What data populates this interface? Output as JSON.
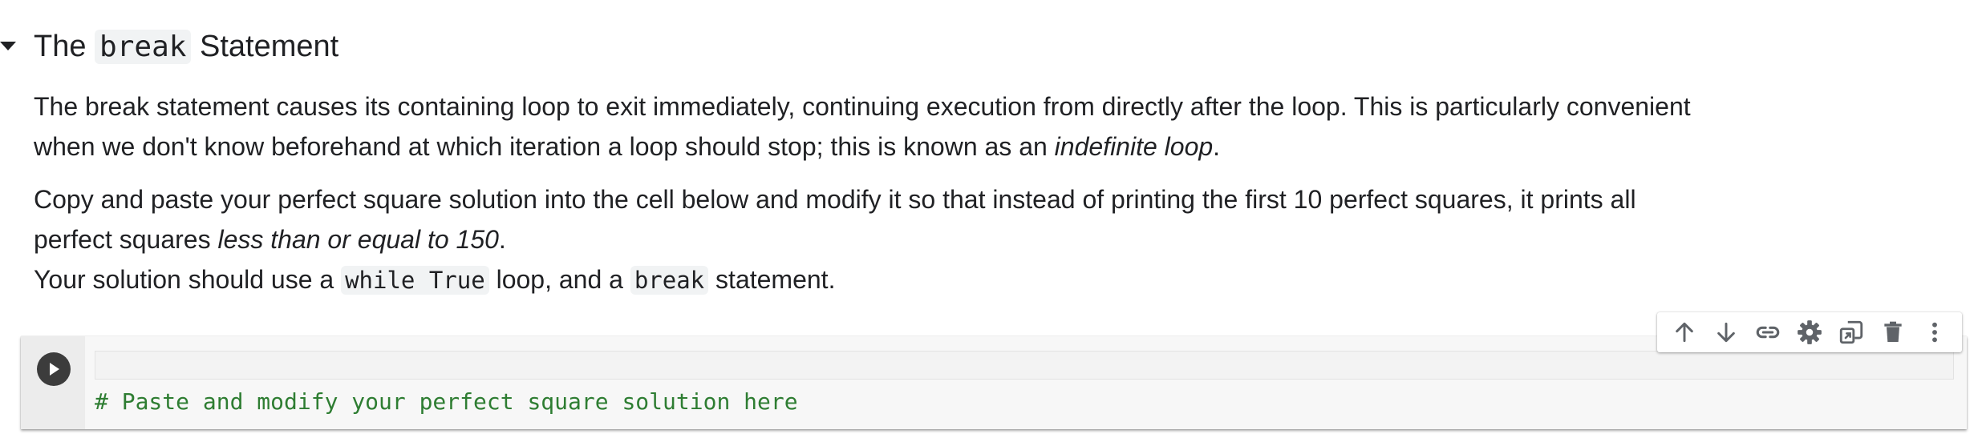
{
  "section": {
    "heading_prefix": "The ",
    "heading_code": "break",
    "heading_suffix": " Statement"
  },
  "paragraph1": {
    "text": "The break statement causes its containing loop to exit immediately, continuing execution from directly after the loop. This is particularly convenient when we don't know beforehand at which iteration a loop should stop; this is known as an ",
    "emphasis": "indefinite loop",
    "end": "."
  },
  "paragraph2": {
    "text": "Copy and paste your perfect square solution into the cell below and modify it so that instead of printing the first 10 perfect squares, it prints all perfect squares ",
    "emphasis": "less than or equal to 150",
    "end": "."
  },
  "paragraph3": {
    "text_a": "Your solution should use a ",
    "code_a": "while True",
    "text_b": " loop, and a ",
    "code_b": "break",
    "text_c": " statement."
  },
  "cell": {
    "code": "# Paste and modify your perfect square solution here"
  },
  "toolbar": {
    "icons": [
      "arrow-up-icon",
      "arrow-down-icon",
      "link-icon",
      "gear-icon",
      "mirror-cell-icon",
      "trash-icon",
      "more-vert-icon"
    ]
  },
  "colors": {
    "comment": "#2e7d32",
    "run_button": "#3c3c3c",
    "cell_background": "#f7f7f7",
    "icon": "#5f6368"
  }
}
